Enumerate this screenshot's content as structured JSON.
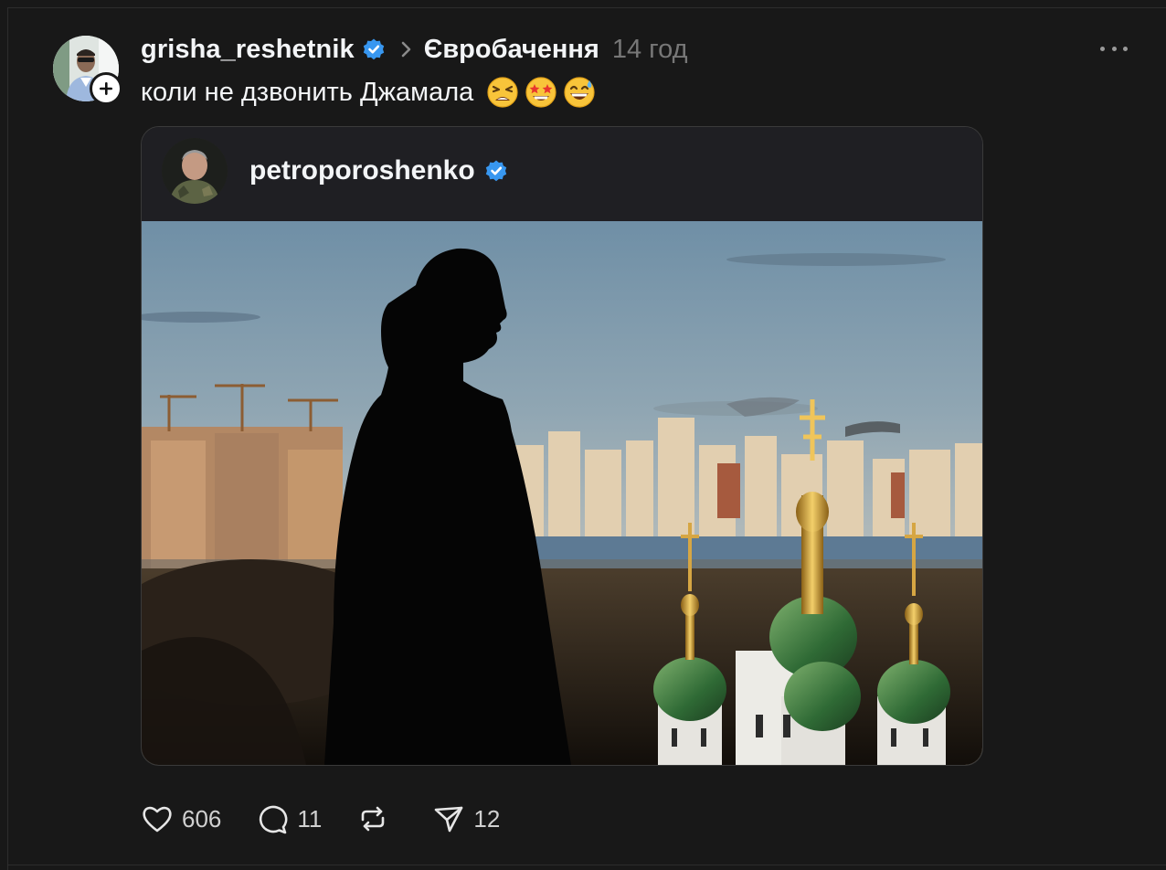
{
  "post": {
    "username": "grisha_reshetnik",
    "community": "Євробачення",
    "time_ago": "14 год",
    "text": "коли не дзвонить Джамала",
    "emojis": [
      "tired-face-emoji",
      "star-struck-emoji",
      "grinning-sweat-emoji"
    ]
  },
  "embedded": {
    "username": "petroporoshenko",
    "image_icon": "photo-silhouette-city-church"
  },
  "actions": {
    "likes": "606",
    "comments": "11",
    "reposts": "",
    "shares": "12"
  },
  "colors": {
    "background": "#181818",
    "verified": "#3897f0",
    "muted": "#777777"
  }
}
